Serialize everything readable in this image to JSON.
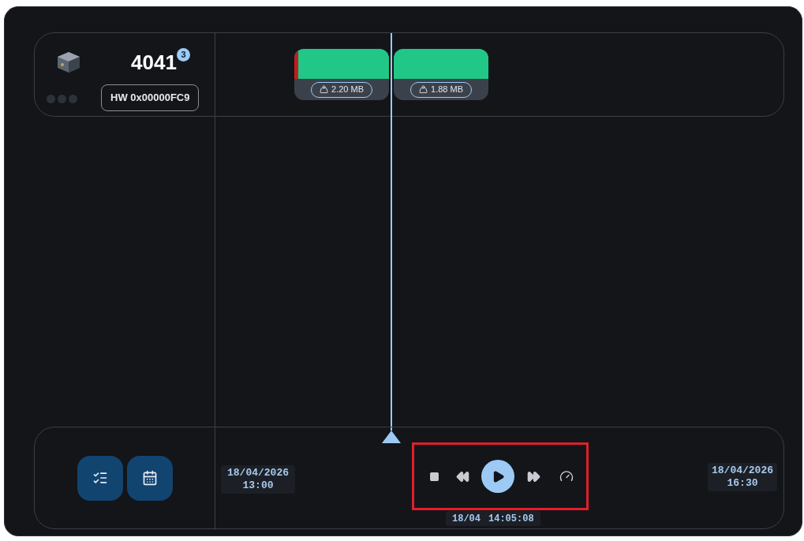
{
  "device": {
    "title": "4041",
    "badge": "3",
    "hardware_id": "HW 0x00000FC9"
  },
  "segments": [
    {
      "size": "2.20 MB",
      "error": true
    },
    {
      "size": "1.88 MB",
      "error": false
    }
  ],
  "timeline": {
    "start": {
      "date": "18/04/2026",
      "time": "13:00"
    },
    "end": {
      "date": "18/04/2026",
      "time": "16:30"
    },
    "current": {
      "date": "18/04",
      "time": "14:05:08"
    }
  },
  "controls": {
    "highlighted": true
  }
}
